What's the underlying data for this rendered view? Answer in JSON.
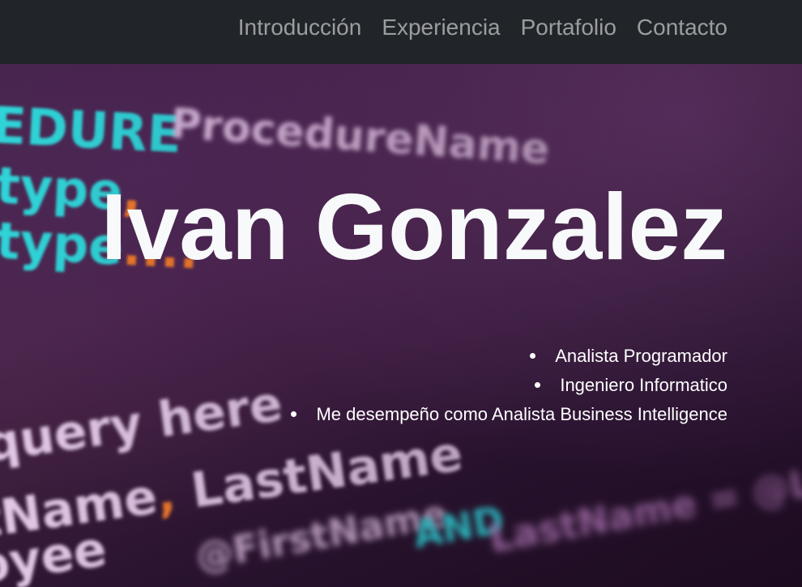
{
  "nav": {
    "items": [
      {
        "label": "Introducción"
      },
      {
        "label": "Experiencia"
      },
      {
        "label": "Portafolio"
      },
      {
        "label": "Contacto"
      }
    ]
  },
  "hero": {
    "title": "Ivan Gonzalez",
    "roles": [
      "Analista Programador",
      "Ingeniero Informatico",
      "Me desempeño como Analista Business Intelligence"
    ],
    "background_code": {
      "line1": "EDURE",
      "line1b": "ProcedureName",
      "line2": "type",
      "line2_suffix": ",",
      "line3": "type",
      "line3_suffix": "....",
      "line4": "query here",
      "line5": "tName",
      "line5_suffix": ",",
      "line5b": " LastName",
      "line6": "oyee",
      "line7": "@FirstName",
      "line7b": "AND",
      "line7c": "LastName = @LastName"
    }
  },
  "colors": {
    "navbar": "#212529",
    "nav_link": "rgba(255,255,255,0.55)",
    "title": "#f8f9fa",
    "code_cyan": "#2fd4d8",
    "code_orange": "#f07a2a"
  }
}
